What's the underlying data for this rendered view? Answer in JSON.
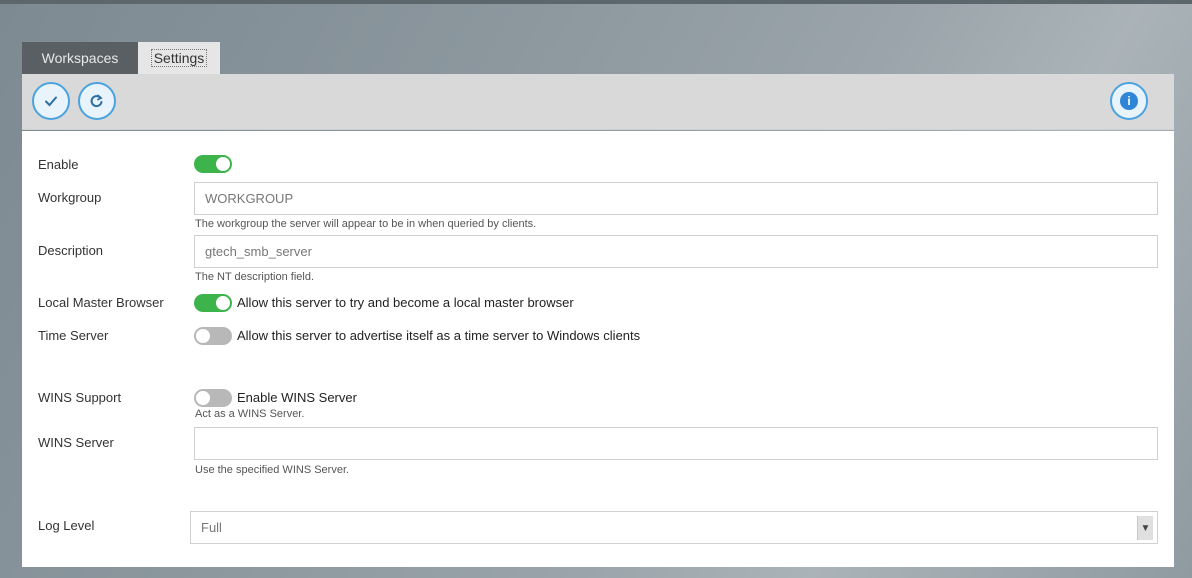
{
  "tabs": [
    {
      "label": "Workspaces"
    },
    {
      "label": "Settings"
    }
  ],
  "toolbar": {
    "apply_icon": "check-icon",
    "refresh_icon": "refresh-icon",
    "info_icon": "info-icon",
    "info_glyph": "i"
  },
  "form": {
    "enable": {
      "label": "Enable",
      "on": true
    },
    "workgroup": {
      "label": "Workgroup",
      "value": "WORKGROUP",
      "hint": "The workgroup the server will appear to be in when queried by clients."
    },
    "description": {
      "label": "Description",
      "value": "gtech_smb_server",
      "hint": "The NT description field."
    },
    "local_master_browser": {
      "label": "Local Master Browser",
      "on": true,
      "text": "Allow this server to try and become a local master browser"
    },
    "time_server": {
      "label": "Time Server",
      "on": false,
      "text": "Allow this server to advertise itself as a time server to Windows clients"
    },
    "wins_support": {
      "label": "WINS Support",
      "on": false,
      "text": "Enable WINS Server",
      "hint": "Act as a WINS Server."
    },
    "wins_server": {
      "label": "WINS Server",
      "value": "",
      "hint": "Use the specified WINS Server."
    },
    "log_level": {
      "label": "Log Level",
      "value": "Full"
    }
  },
  "colors": {
    "toggle_on": "#3cb44b",
    "toggle_off": "#b8b8b8",
    "accent": "#4aa3df"
  }
}
